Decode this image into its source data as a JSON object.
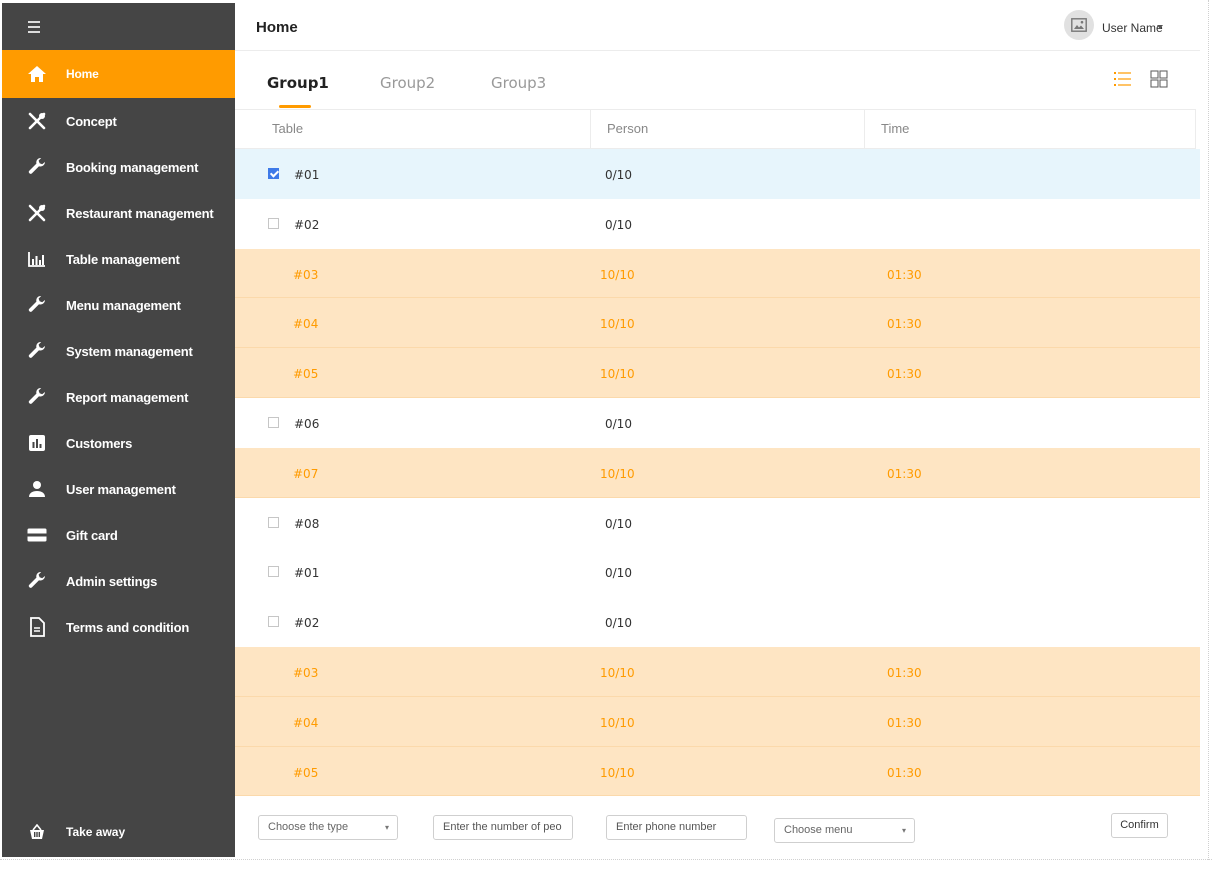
{
  "sidebar": {
    "items": [
      {
        "label": "Home",
        "icon": "home-icon",
        "active": true
      },
      {
        "label": "Concept",
        "icon": "utensils-cross-icon"
      },
      {
        "label": "Booking management",
        "icon": "wrench-icon"
      },
      {
        "label": "Restaurant management",
        "icon": "utensils-cross-icon"
      },
      {
        "label": "Table management",
        "icon": "bar-chart-icon"
      },
      {
        "label": "Menu management",
        "icon": "wrench-icon"
      },
      {
        "label": "System management",
        "icon": "wrench-icon"
      },
      {
        "label": "Report management",
        "icon": "wrench-icon"
      },
      {
        "label": "Customers",
        "icon": "chart-box-icon"
      },
      {
        "label": "User management",
        "icon": "user-icon"
      },
      {
        "label": "Gift card",
        "icon": "card-icon"
      },
      {
        "label": "Admin settings",
        "icon": "wrench-icon"
      },
      {
        "label": "Terms and condition",
        "icon": "document-icon"
      }
    ],
    "takeaway": {
      "label": "Take away",
      "icon": "basket-icon"
    }
  },
  "header": {
    "title": "Home",
    "user_name": "User Name"
  },
  "tabs": [
    {
      "label": "Group1",
      "active": true
    },
    {
      "label": "Group2"
    },
    {
      "label": "Group3"
    }
  ],
  "table": {
    "columns": [
      "Table",
      "Person",
      "Time"
    ],
    "rows": [
      {
        "table": "#01",
        "person": "0/10",
        "time": "",
        "state": "selected"
      },
      {
        "table": "#02",
        "person": "0/10",
        "time": "",
        "state": "empty"
      },
      {
        "table": "#03",
        "person": "10/10",
        "time": "01:30",
        "state": "full"
      },
      {
        "table": "#04",
        "person": "10/10",
        "time": "01:30",
        "state": "full"
      },
      {
        "table": "#05",
        "person": "10/10",
        "time": "01:30",
        "state": "full"
      },
      {
        "table": "#06",
        "person": "0/10",
        "time": "",
        "state": "empty"
      },
      {
        "table": "#07",
        "person": "10/10",
        "time": "01:30",
        "state": "full"
      },
      {
        "table": "#08",
        "person": "0/10",
        "time": "",
        "state": "empty"
      },
      {
        "table": "#01",
        "person": "0/10",
        "time": "",
        "state": "empty"
      },
      {
        "table": "#02",
        "person": "0/10",
        "time": "",
        "state": "empty"
      },
      {
        "table": "#03",
        "person": "10/10",
        "time": "01:30",
        "state": "full"
      },
      {
        "table": "#04",
        "person": "10/10",
        "time": "01:30",
        "state": "full"
      },
      {
        "table": "#05",
        "person": "10/10",
        "time": "01:30",
        "state": "full"
      }
    ]
  },
  "footer": {
    "type_select": "Choose the type",
    "people_placeholder": "Enter the number of peo",
    "phone_placeholder": "Enter phone number",
    "menu_select": "Choose menu",
    "confirm_label": "Confirm"
  },
  "colors": {
    "accent": "#ff9b00",
    "sidebar_bg": "#454545",
    "full_row_bg": "#fee5c3",
    "selected_row_bg": "#e7f5fc",
    "checkbox_checked": "#3e7ae8"
  }
}
